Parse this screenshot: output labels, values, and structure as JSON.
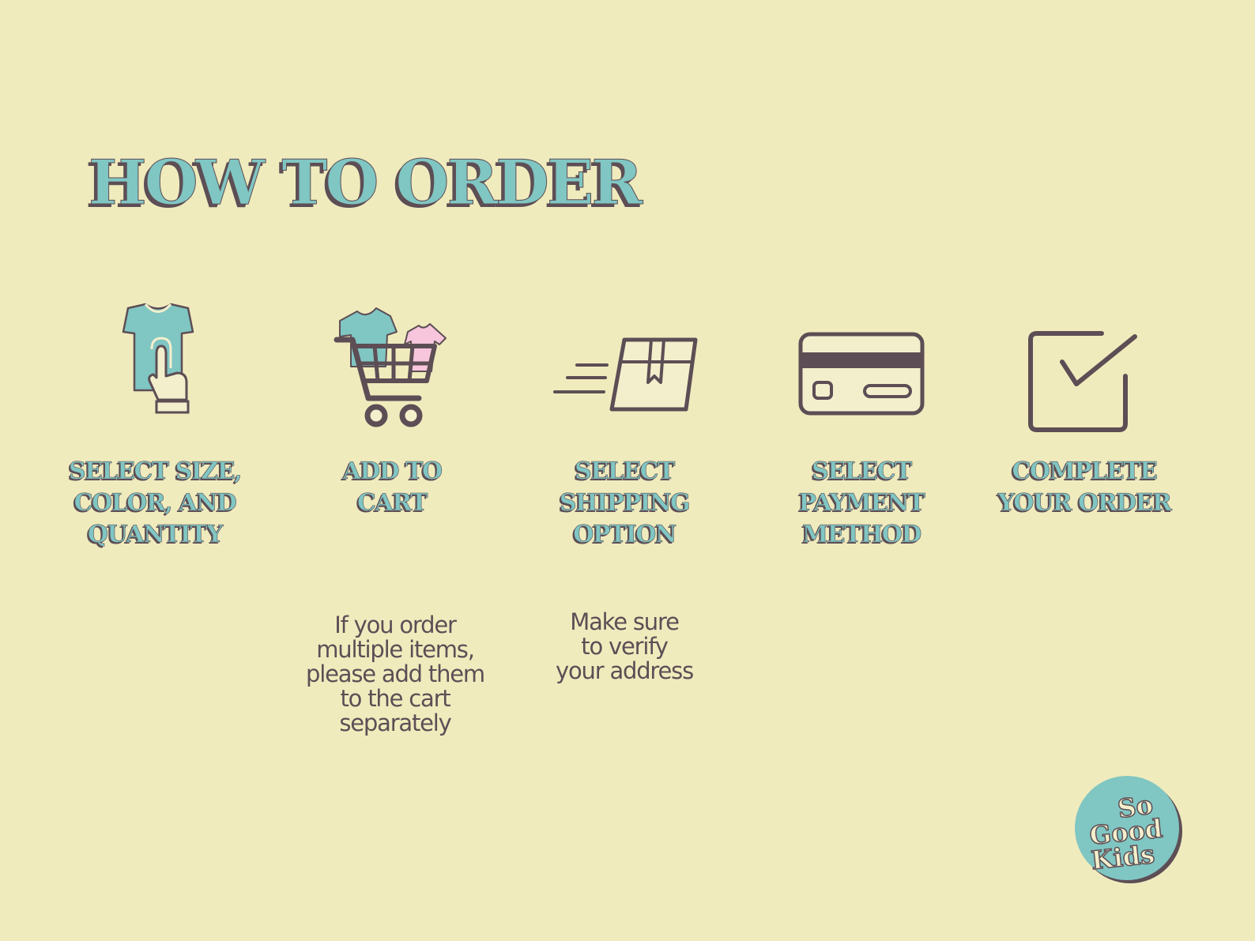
{
  "title": "HOW TO ORDER",
  "steps": [
    {
      "label": "SELECT SIZE,\nCOLOR, AND\nQUANTITY",
      "icon": "tshirt-tap-icon"
    },
    {
      "label": "ADD TO\nCART",
      "icon": "shopping-cart-icon"
    },
    {
      "label": "SELECT\nSHIPPING\nOPTION",
      "icon": "shipping-box-icon"
    },
    {
      "label": "SELECT\nPAYMENT\nMETHOD",
      "icon": "credit-card-icon"
    },
    {
      "label": "COMPLETE\nYOUR ORDER",
      "icon": "checkbox-icon"
    }
  ],
  "notes": {
    "cart": "If you order\nmultiple items,\nplease add them\nto the cart\nseparately",
    "shipping": "Make sure\nto verify\nyour address"
  },
  "logo": {
    "text": "So Good Kids",
    "icon": "so-good-kids-logo"
  },
  "colors": {
    "background": "#f0ebbd",
    "teal": "#80c6c3",
    "dark": "#5d4e55",
    "pink": "#f7c6dc",
    "cream": "#f3efcc"
  }
}
